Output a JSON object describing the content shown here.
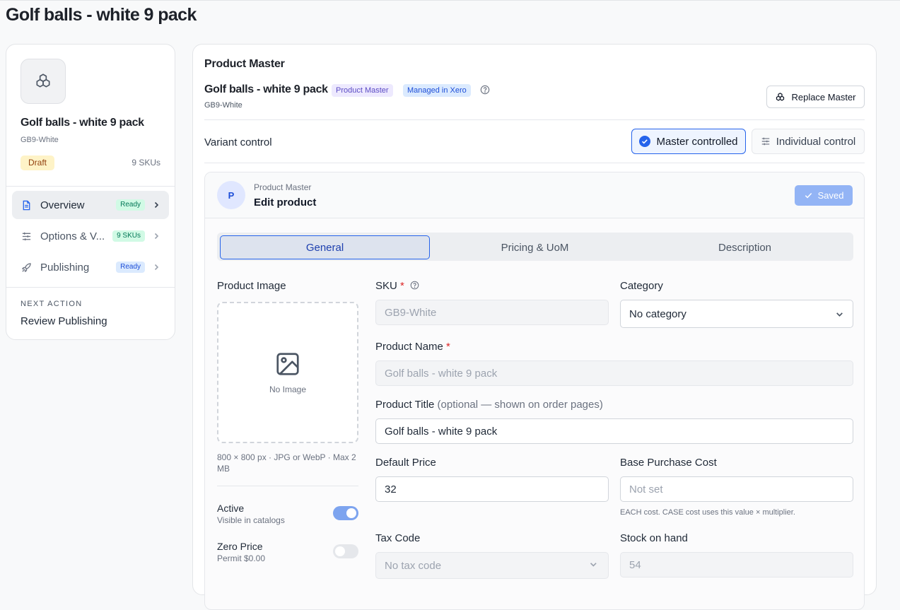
{
  "page": {
    "title": "Golf balls - white 9 pack"
  },
  "sidebar": {
    "product_name": "Golf balls - white 9 pack",
    "sku": "GB9-White",
    "status_badge": "Draft",
    "sku_count": "9 SKUs",
    "nav": [
      {
        "label": "Overview",
        "badge": "Ready",
        "icon": "document-icon"
      },
      {
        "label": "Options & V...",
        "badge": "9 SKUs",
        "icon": "sliders-icon"
      },
      {
        "label": "Publishing",
        "badge": "Ready",
        "icon": "rocket-icon"
      }
    ],
    "next_action_label": "NEXT ACTION",
    "next_action_value": "Review Publishing"
  },
  "main": {
    "heading": "Product Master",
    "product_name": "Golf balls - white 9 pack",
    "pill_product_master": "Product Master",
    "pill_xero": "Managed in Xero",
    "sku": "GB9-White",
    "replace_button": "Replace Master",
    "variant_control_label": "Variant control",
    "master_controlled": "Master controlled",
    "individual_control": "Individual control"
  },
  "edit": {
    "avatar_letter": "P",
    "subtitle": "Product Master",
    "title": "Edit product",
    "saved_button": "Saved",
    "tabs": [
      "General",
      "Pricing & UoM",
      "Description"
    ],
    "product_image_label": "Product Image",
    "no_image": "No Image",
    "image_hint": "800 × 800 px · JPG or WebP · Max 2 MB",
    "sku_label": "SKU",
    "sku_value": "GB9-White",
    "category_label": "Category",
    "category_value": "No category",
    "product_name_label": "Product Name",
    "product_name_value": "Golf balls - white 9 pack",
    "product_title_label": "Product Title",
    "product_title_optional": "(optional — shown on order pages)",
    "product_title_value": "Golf balls - white 9 pack",
    "default_price_label": "Default Price",
    "default_price_value": "32",
    "base_cost_label": "Base Purchase Cost",
    "base_cost_placeholder": "Not set",
    "base_cost_hint": "EACH cost. CASE cost uses this value × multiplier.",
    "active_label": "Active",
    "active_sub": "Visible in catalogs",
    "active_on": true,
    "zero_price_label": "Zero Price",
    "zero_price_sub": "Permit $0.00",
    "zero_price_on": false,
    "tax_code_label": "Tax Code",
    "tax_code_value": "No tax code",
    "stock_label": "Stock on hand",
    "stock_value": "54"
  },
  "colors": {
    "accent": "#2563eb",
    "saved": "#93b4f5",
    "toggle_on": "#7da4ef"
  }
}
